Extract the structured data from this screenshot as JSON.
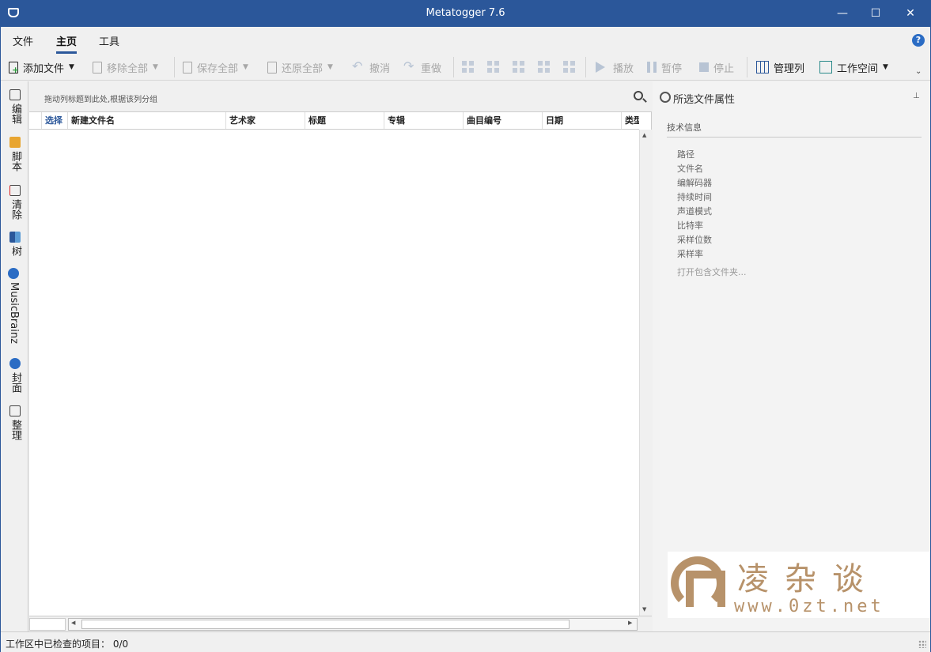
{
  "window": {
    "title": "Metatogger 7.6",
    "min": "—",
    "max": "☐",
    "close": "✕"
  },
  "menu": {
    "tabs": [
      "文件",
      "主页",
      "工具"
    ],
    "help": "?"
  },
  "toolbar": {
    "add_files": "添加文件",
    "remove_all": "移除全部",
    "save_all": "保存全部",
    "restore_all": "还原全部",
    "undo": "撤消",
    "redo": "重做",
    "play": "播放",
    "pause": "暂停",
    "stop": "停止",
    "manage_columns": "管理列",
    "workspace": "工作空间",
    "caret": "▼",
    "expand": "⌄"
  },
  "sidebar": {
    "items": [
      "编辑",
      "脚本",
      "清除",
      "树",
      "MusicBrainz",
      "封面",
      "整理"
    ]
  },
  "grid": {
    "group_hint": "拖动列标题到此处,根据该列分组",
    "columns": [
      "选择",
      "新建文件名",
      "艺术家",
      "标题",
      "专辑",
      "曲目编号",
      "日期",
      "类型"
    ],
    "up": "▲",
    "down": "▼",
    "left": "◀",
    "right": "▶"
  },
  "properties": {
    "title": "所选文件属性",
    "pin": "⊥",
    "section": "技术信息",
    "fields": [
      "路径",
      "文件名",
      "编解码器",
      "持续时间",
      "声道模式",
      "比特率",
      "采样位数",
      "采样率"
    ],
    "open_folder": "打开包含文件夹..."
  },
  "watermark": {
    "name": "凌杂谈",
    "url": "www.0zt.net"
  },
  "status": {
    "text": "工作区中已检查的项目： 0/0"
  },
  "colors": {
    "accent": "#2b579a",
    "watermark": "#b7926a"
  }
}
